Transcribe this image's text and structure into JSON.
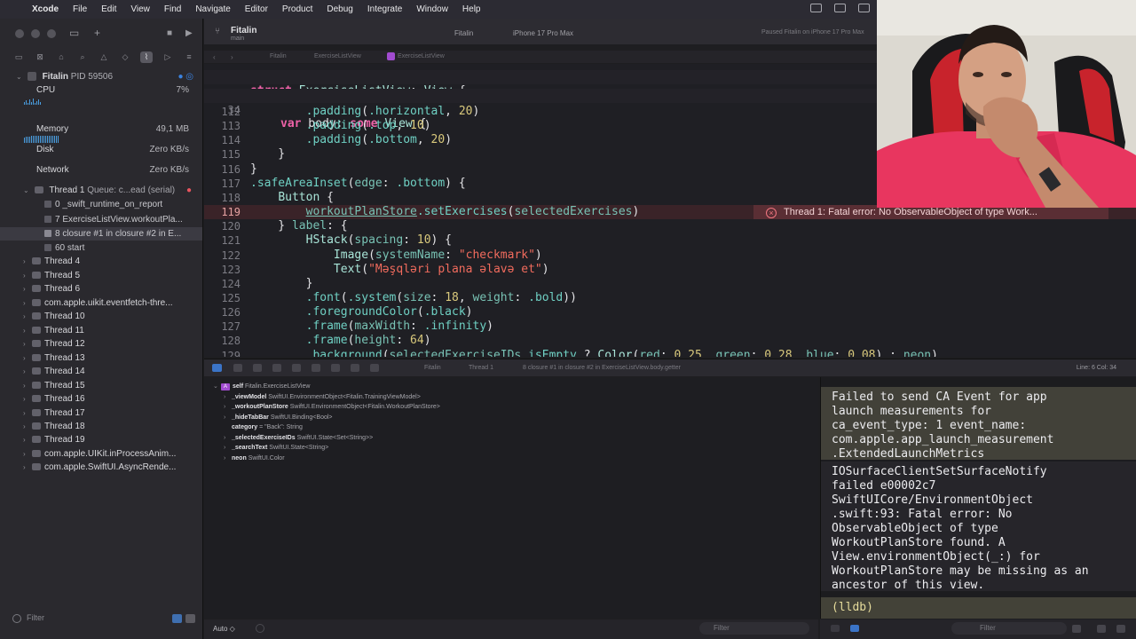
{
  "menubar": {
    "app_name": "Xcode",
    "menus": [
      "File",
      "Edit",
      "View",
      "Find",
      "Navigate",
      "Editor",
      "Product",
      "Debug",
      "Integrate",
      "Window",
      "Help"
    ]
  },
  "toolbar": {
    "project_title": "Fitalin",
    "branch": "main",
    "scheme": "Fitalin",
    "destination": "iPhone 17 Pro Max",
    "status": "Paused Fitalin on iPhone 17 Pro Max"
  },
  "jumpbar": {
    "items": [
      "Fitalin",
      "ExerciseListView",
      "ExerciseListView"
    ]
  },
  "navigator": {
    "process": {
      "name": "Fitalin",
      "pid": "PID 59506"
    },
    "gauges": [
      {
        "label": "CPU",
        "value": "7%"
      },
      {
        "label": "Memory",
        "value": "49,1 MB"
      },
      {
        "label": "Disk",
        "value": "Zero KB/s"
      },
      {
        "label": "Network",
        "value": "Zero KB/s"
      }
    ],
    "thread1": {
      "label": "Thread 1",
      "queue": "Queue: c...ead (serial)"
    },
    "frames": [
      "0 _swift_runtime_on_report",
      "7 ExerciseListView.workoutPla...",
      "8 closure #1 in closure #2 in E...",
      "60 start"
    ],
    "threads": [
      "Thread 4",
      "Thread 5",
      "Thread 6",
      "com.apple.uikit.eventfetch-thre...",
      "Thread 10",
      "Thread 11",
      "Thread 12",
      "Thread 13",
      "Thread 14",
      "Thread 15",
      "Thread 16",
      "Thread 17",
      "Thread 18",
      "Thread 19",
      "com.apple.UIKit.inProcessAnim...",
      "com.apple.SwiftUI.AsyncRende..."
    ],
    "filter_placeholder": "Filter"
  },
  "editor": {
    "sticky": [
      {
        "num": "",
        "html_key": "struct"
      },
      {
        "num": "34",
        "html_key": "body"
      }
    ],
    "lines": [
      {
        "num": "112",
        "text": "            .padding(.horizontal, 20)"
      },
      {
        "num": "113",
        "text": "            .padding(.top, 10)"
      },
      {
        "num": "114",
        "text": "            .padding(.bottom, 20)"
      },
      {
        "num": "115",
        "text": "        }"
      },
      {
        "num": "116",
        "text": "    }"
      },
      {
        "num": "117",
        "text": "    .safeAreaInset(edge: .bottom) {"
      },
      {
        "num": "118",
        "text": "        Button {"
      },
      {
        "num": "119",
        "text": "            workoutPlanStore.setExercises(selectedExercises)"
      },
      {
        "num": "120",
        "text": "        } label: {"
      },
      {
        "num": "121",
        "text": "            HStack(spacing: 10) {"
      },
      {
        "num": "122",
        "text": "                Image(systemName: \"checkmark\")"
      },
      {
        "num": "123",
        "text": "                Text(\"Məşqləri plana əlavə et\")"
      },
      {
        "num": "124",
        "text": "            }"
      },
      {
        "num": "125",
        "text": "            .font(.system(size: 18, weight: .bold))"
      },
      {
        "num": "126",
        "text": "            .foregroundColor(.black)"
      },
      {
        "num": "127",
        "text": "            .frame(maxWidth: .infinity)"
      },
      {
        "num": "128",
        "text": "            .frame(height: 64)"
      },
      {
        "num": "129",
        "text": "            .background(selectedExerciseIDs.isEmpty ? Color(red: 0.25, green: 0.28, blue: 0.08) : neon)"
      }
    ],
    "error_message": "Thread 1: Fatal error: No ObservableObject of type Work...",
    "error_line": "119"
  },
  "debugbar": {
    "crumbs": [
      "Fitalin",
      "Thread 1",
      "8 closure #1 in closure #2 in ExerciseListView.body.getter"
    ],
    "cursor": "Line: 6  Col: 34"
  },
  "variables": [
    {
      "expand": "⌄",
      "badge": "A",
      "name": "self",
      "type": "Fitalin.ExerciseListView"
    },
    {
      "expand": "›",
      "name": "_viewModel",
      "type": "SwiftUI.EnvironmentObject<Fitalin.TrainingViewModel>"
    },
    {
      "expand": "›",
      "name": "_workoutPlanStore",
      "type": "SwiftUI.EnvironmentObject<Fitalin.WorkoutPlanStore>"
    },
    {
      "expand": "›",
      "name": "_hideTabBar",
      "type": "SwiftUI.Binding<Bool>"
    },
    {
      "expand": "",
      "name": "category",
      "type": "= \"Back\": String"
    },
    {
      "expand": "›",
      "name": "_selectedExerciseIDs",
      "type": "SwiftUI.State<Set<String>>"
    },
    {
      "expand": "›",
      "name": "_searchText",
      "type": "SwiftUI.State<String>"
    },
    {
      "expand": "›",
      "name": "neon",
      "type": "SwiftUI.Color"
    }
  ],
  "variables_footer": {
    "scope": "Auto ◇",
    "filter_placeholder": "Filter"
  },
  "console": {
    "message1": "Failed to send CA Event for app\nlaunch measurements for\nca_event_type: 1 event_name:\ncom.apple.app_launch_measurement\n.ExtendedLaunchMetrics",
    "message2": "IOSurfaceClientSetSurfaceNotify\nfailed e00002c7\nSwiftUICore/EnvironmentObject\n.swift:93: Fatal error: No\nObservableObject of type\nWorkoutPlanStore found. A\nView.environmentObject(_:) for\nWorkoutPlanStore may be missing as an\nancestor of this view.",
    "prompt": "(lldb)",
    "filter_placeholder": "Filter"
  },
  "colors": {
    "error_background": "#5a2e34",
    "keyword": "#ee62a8",
    "string": "#f16b5d",
    "number": "#d9c97c",
    "console_highlight": "#424139"
  },
  "icons": [
    "apple-logo-icon",
    "error-x-icon",
    "filter-icon",
    "thread-icon",
    "gauge-icon",
    "process-icon",
    "swift-file-icon"
  ]
}
